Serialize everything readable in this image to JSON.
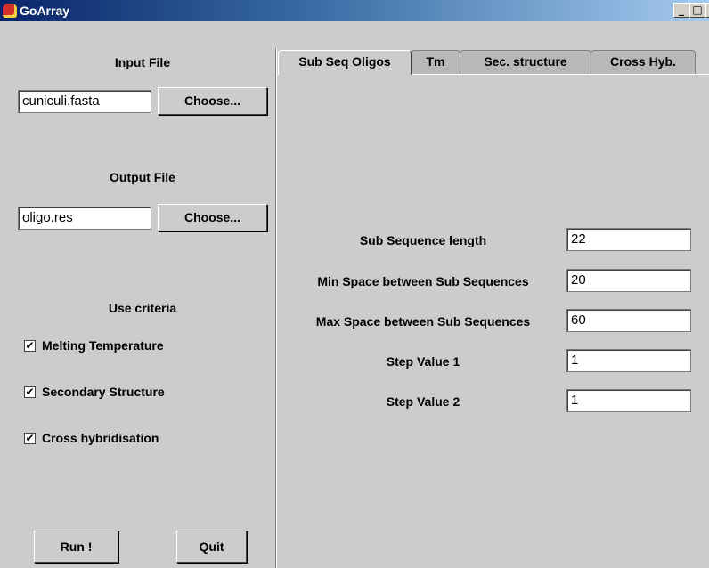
{
  "window": {
    "title": "GoArray"
  },
  "left_panel": {
    "input_file_label": "Input File",
    "input_file_value": "cuniculi.fasta",
    "input_choose": "Choose...",
    "output_file_label": "Output File",
    "output_file_value": "oligo.res",
    "output_choose": "Choose...",
    "criteria_label": "Use criteria",
    "criteria": [
      {
        "label": "Melting Temperature",
        "checked": true
      },
      {
        "label": "Secondary Structure",
        "checked": true
      },
      {
        "label": "Cross hybridisation",
        "checked": true
      }
    ],
    "run_button": "Run !",
    "quit_button": "Quit"
  },
  "tabs": [
    {
      "label": "Sub Seq Oligos",
      "active": true
    },
    {
      "label": "Tm",
      "active": false
    },
    {
      "label": "Sec. structure",
      "active": false
    },
    {
      "label": "Cross Hyb.",
      "active": false
    }
  ],
  "params": [
    {
      "label": "Sub Sequence length",
      "value": "22"
    },
    {
      "label": "Min Space between Sub Sequences",
      "value": "20"
    },
    {
      "label": "Max Space between Sub Sequences",
      "value": "60"
    },
    {
      "label": "Step Value 1",
      "value": "1"
    },
    {
      "label": "Step Value 2",
      "value": "1"
    }
  ],
  "glyphs": {
    "check": "✔",
    "minimize": "_",
    "maximize": "□",
    "close": "×"
  }
}
